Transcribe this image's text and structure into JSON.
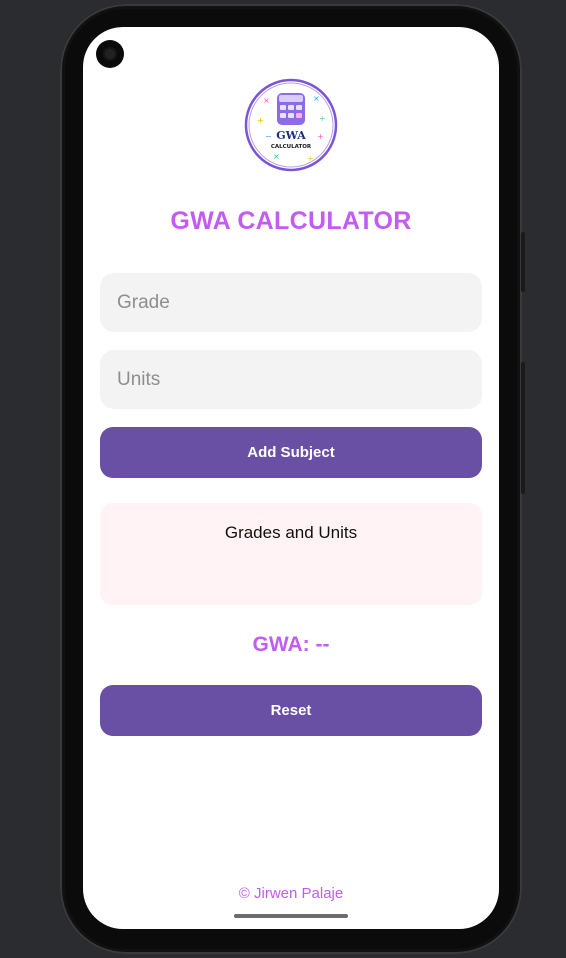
{
  "app": {
    "title": "GWA CALCULATOR",
    "logo": {
      "main_text": "GWA",
      "sub_text": "CALCULATOR"
    }
  },
  "form": {
    "grade_placeholder": "Grade",
    "grade_value": "",
    "units_placeholder": "Units",
    "units_value": "",
    "add_label": "Add Subject"
  },
  "list": {
    "title": "Grades and Units"
  },
  "result": {
    "gwa_text": "GWA: --"
  },
  "actions": {
    "reset_label": "Reset"
  },
  "footer": {
    "credit": "© Jirwen Palaje"
  },
  "colors": {
    "accent": "#c35cf0",
    "button": "#6a50a4",
    "field_bg": "#f3f3f3",
    "list_bg": "#fff3f6"
  },
  "icons": [
    "camera-icon",
    "calculator-icon"
  ]
}
